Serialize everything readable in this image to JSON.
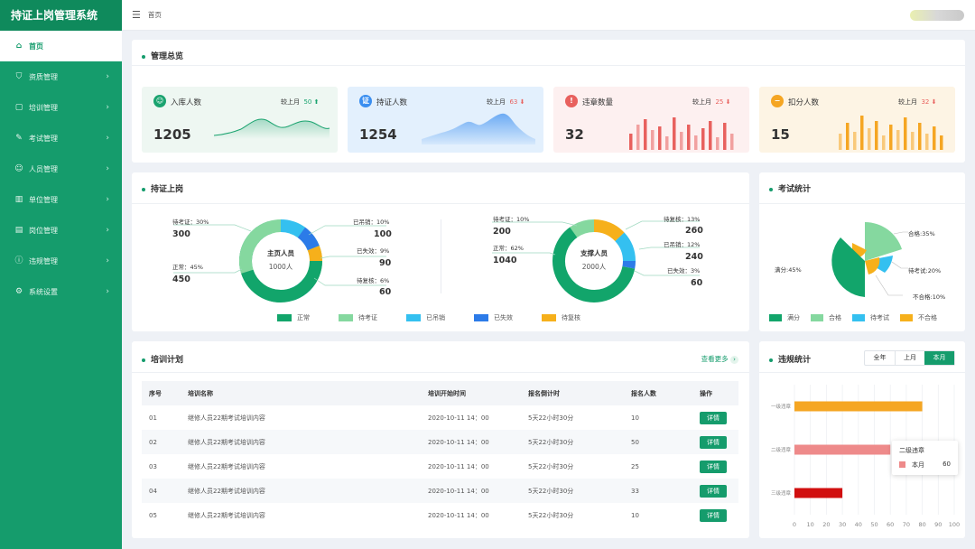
{
  "app": {
    "title": "持证上岗管理系统"
  },
  "sidebar": {
    "items": [
      {
        "label": "首页",
        "icon": "home-icon"
      },
      {
        "label": "资质管理",
        "icon": "shield-icon"
      },
      {
        "label": "培训管理",
        "icon": "box-icon"
      },
      {
        "label": "考试管理",
        "icon": "pen-icon"
      },
      {
        "label": "人员管理",
        "icon": "user-icon"
      },
      {
        "label": "单位管理",
        "icon": "building-icon"
      },
      {
        "label": "岗位管理",
        "icon": "briefcase-icon"
      },
      {
        "label": "违规管理",
        "icon": "alert-icon"
      },
      {
        "label": "系统设置",
        "icon": "gear-icon"
      }
    ]
  },
  "header": {
    "breadcrumb": "首页"
  },
  "overview": {
    "title": "管理总览",
    "cards": [
      {
        "label": "入库人数",
        "compare": "较上月",
        "delta": "50",
        "value": "1205",
        "color": "#1aa36f",
        "bg": "#eef7f2",
        "icon": "user-circle-icon"
      },
      {
        "label": "持证人数",
        "compare": "较上月",
        "delta": "63",
        "value": "1254",
        "color": "#3a8ef0",
        "bg": "#e3f0fd",
        "icon": "certificate-icon"
      },
      {
        "label": "违章数量",
        "compare": "较上月",
        "delta": "25",
        "value": "32",
        "color": "#e8615e",
        "bg": "#fdf0f0",
        "icon": "warning-icon"
      },
      {
        "label": "扣分人数",
        "compare": "较上月",
        "delta": "32",
        "value": "15",
        "color": "#f5a623",
        "bg": "#fdf4e4",
        "icon": "minus-circle-icon"
      }
    ]
  },
  "certified": {
    "title": "持证上岗",
    "left": {
      "center_title": "主页人员",
      "center_value": "1000人",
      "labels": [
        {
          "text": "待考证：30%",
          "value": "300"
        },
        {
          "text": "正常：45%",
          "value": "450"
        },
        {
          "text": "已吊销：10%",
          "value": "100"
        },
        {
          "text": "已失效：9%",
          "value": "90"
        },
        {
          "text": "待复核：6%",
          "value": "60"
        }
      ]
    },
    "right": {
      "center_title": "支撑人员",
      "center_value": "2000人",
      "labels": [
        {
          "text": "待考证：10%",
          "value": "200"
        },
        {
          "text": "正常：62%",
          "value": "1040"
        },
        {
          "text": "待复核：13%",
          "value": "260"
        },
        {
          "text": "已吊销：12%",
          "value": "240"
        },
        {
          "text": "已失效：3%",
          "value": "60"
        }
      ]
    },
    "legend": [
      {
        "name": "正常",
        "color": "#12a56b"
      },
      {
        "name": "待考证",
        "color": "#85d89f"
      },
      {
        "name": "已吊销",
        "color": "#34c0f0"
      },
      {
        "name": "已失效",
        "color": "#2c7be8"
      },
      {
        "name": "待复核",
        "color": "#f6b01b"
      }
    ]
  },
  "exam": {
    "title": "考试统计",
    "labels": [
      "合格:35%",
      "满分:45%",
      "待考试:20%",
      "不合格:10%"
    ],
    "legend": [
      {
        "name": "满分",
        "color": "#12a56b"
      },
      {
        "name": "合格",
        "color": "#85d89f"
      },
      {
        "name": "待考试",
        "color": "#34c0f0"
      },
      {
        "name": "不合格",
        "color": "#f6b01b"
      }
    ]
  },
  "training": {
    "title": "培训计划",
    "more": "查看更多",
    "headers": [
      "序号",
      "培训名称",
      "培训开始时间",
      "报名倒计时",
      "报名人数",
      "操作"
    ],
    "rows": [
      {
        "no": "01",
        "name": "继修人员22期考试培训内容",
        "start": "2020-10-11  14：00",
        "countdown": "5天22小时30分",
        "count": "10",
        "action": "详情"
      },
      {
        "no": "02",
        "name": "继修人员22期考试培训内容",
        "start": "2020-10-11  14：00",
        "countdown": "5天22小时30分",
        "count": "50",
        "action": "详情"
      },
      {
        "no": "03",
        "name": "继修人员22期考试培训内容",
        "start": "2020-10-11  14：00",
        "countdown": "5天22小时30分",
        "count": "25",
        "action": "详情"
      },
      {
        "no": "04",
        "name": "继修人员22期考试培训内容",
        "start": "2020-10-11  14：00",
        "countdown": "5天22小时30分",
        "count": "33",
        "action": "详情"
      },
      {
        "no": "05",
        "name": "继修人员22期考试培训内容",
        "start": "2020-10-11  14：00",
        "countdown": "5天22小时30分",
        "count": "10",
        "action": "详情"
      }
    ]
  },
  "violation": {
    "title": "违规统计",
    "tabs": [
      "全年",
      "上月",
      "本月"
    ],
    "active_tab": "本月",
    "tooltip": {
      "title": "二级违章",
      "series": "本月",
      "value": "60"
    }
  },
  "chart_data": {
    "type": "bar",
    "orientation": "horizontal",
    "categories": [
      "一级违章",
      "二级违章",
      "三级违章"
    ],
    "series": [
      {
        "name": "本月",
        "values": [
          80,
          60,
          30
        ]
      }
    ],
    "colors": [
      "#f5a623",
      "#ee8a8a",
      "#d10f0f"
    ],
    "xlim": [
      0,
      100
    ],
    "xticks": [
      0,
      10,
      20,
      30,
      40,
      50,
      60,
      70,
      80,
      90,
      100
    ]
  }
}
